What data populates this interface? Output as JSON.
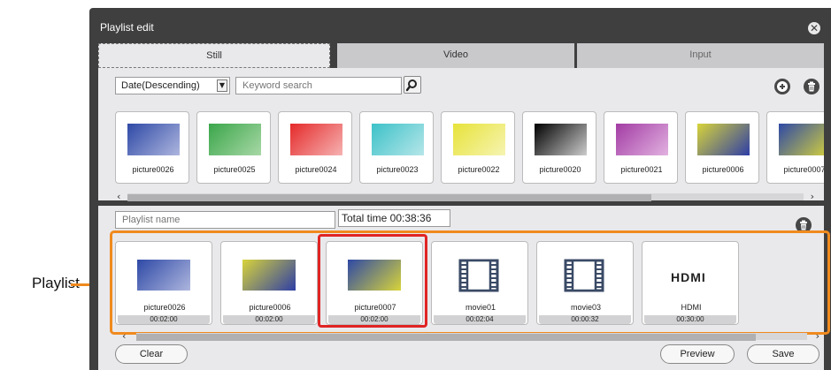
{
  "dialog": {
    "title": "Playlist edit",
    "close_icon": "close-icon"
  },
  "tabs": [
    {
      "label": "Still",
      "active": true
    },
    {
      "label": "Video",
      "active": false
    },
    {
      "label": "Input",
      "active": false
    }
  ],
  "library": {
    "sort_value": "Date(Descending)",
    "search_placeholder": "Keyword search",
    "items": [
      {
        "name": "picture0026",
        "gradient": [
          "#2e49a6",
          "#aeb6de"
        ]
      },
      {
        "name": "picture0025",
        "gradient": [
          "#3aa64a",
          "#a8d8a6"
        ]
      },
      {
        "name": "picture0024",
        "gradient": [
          "#e52a2a",
          "#f6b2b2"
        ]
      },
      {
        "name": "picture0023",
        "gradient": [
          "#3cc2c8",
          "#b6e6e9"
        ]
      },
      {
        "name": "picture0022",
        "gradient": [
          "#e7e33a",
          "#f6f4b2"
        ]
      },
      {
        "name": "picture0020",
        "gradient": [
          "#000000",
          "#cccccc"
        ]
      },
      {
        "name": "picture0021",
        "gradient": [
          "#a23ca4",
          "#e2b2e0"
        ]
      },
      {
        "name": "picture0006",
        "gradient": [
          "#d8d43a",
          "#2e3ea6"
        ]
      },
      {
        "name": "picture0007",
        "gradient": [
          "#2e49a6",
          "#d8d43a"
        ]
      }
    ]
  },
  "playlist": {
    "name_placeholder": "Playlist name",
    "total_time": "Total time 00:38:36",
    "callout_label": "Playlist",
    "items": [
      {
        "name": "picture0026",
        "duration": "00:02:00",
        "kind": "image",
        "gradient": [
          "#2e49a6",
          "#aeb6de"
        ]
      },
      {
        "name": "picture0006",
        "duration": "00:02:00",
        "kind": "image",
        "gradient": [
          "#d8d43a",
          "#2e3ea6"
        ]
      },
      {
        "name": "picture0007",
        "duration": "00:02:00",
        "kind": "image",
        "gradient": [
          "#2e49a6",
          "#d8d43a"
        ]
      },
      {
        "name": "movie01",
        "duration": "00:02:04",
        "kind": "video"
      },
      {
        "name": "movie03",
        "duration": "00:00:32",
        "kind": "video"
      },
      {
        "name": "HDMI",
        "duration": "00:30:00",
        "kind": "input",
        "logo_text": "HDMI"
      }
    ]
  },
  "buttons": {
    "clear": "Clear",
    "preview": "Preview",
    "save": "Save"
  },
  "colors": {
    "dialog_bg": "#3f3f3f",
    "panel_bg": "#e9e9ec",
    "callout": "#f08a1e",
    "selected": "#e02424"
  }
}
